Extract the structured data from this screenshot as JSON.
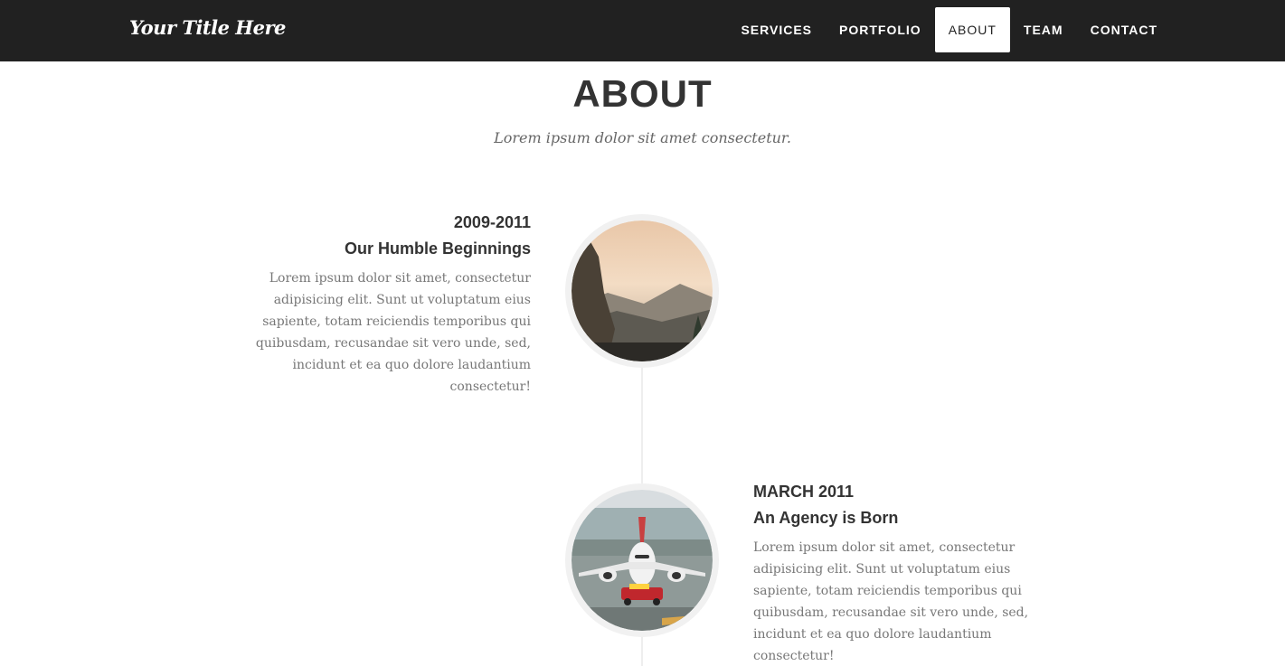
{
  "header": {
    "brand": "Your Title Here",
    "nav": [
      {
        "label": "SERVICES",
        "active": false
      },
      {
        "label": "PORTFOLIO",
        "active": false
      },
      {
        "label": "ABOUT",
        "active": true
      },
      {
        "label": "TEAM",
        "active": false
      },
      {
        "label": "CONTACT",
        "active": false
      }
    ]
  },
  "section": {
    "title": "ABOUT",
    "subtitle": "Lorem ipsum dolor sit amet consectetur."
  },
  "timeline": [
    {
      "date": "2009-2011",
      "title": "Our Humble Beginnings",
      "body": "Lorem ipsum dolor sit amet, consectetur adipisicing elit. Sunt ut voluptatum eius sapiente, totam reiciendis temporibus qui quibusdam, recusandae sit vero unde, sed, incidunt et ea quo dolore laudantium consectetur!",
      "image": "mountain-sunset-photo"
    },
    {
      "date": "MARCH 2011",
      "title": "An Agency is Born",
      "body": "Lorem ipsum dolor sit amet, consectetur adipisicing elit. Sunt ut voluptatum eius sapiente, totam reiciendis temporibus qui quibusdam, recusandae sit vero unde, sed, incidunt et ea quo dolore laudantium consectetur!",
      "image": "airplane-photo"
    }
  ],
  "colors": {
    "navbar_bg": "#212121",
    "text_dark": "#333333",
    "text_muted": "#777777"
  }
}
